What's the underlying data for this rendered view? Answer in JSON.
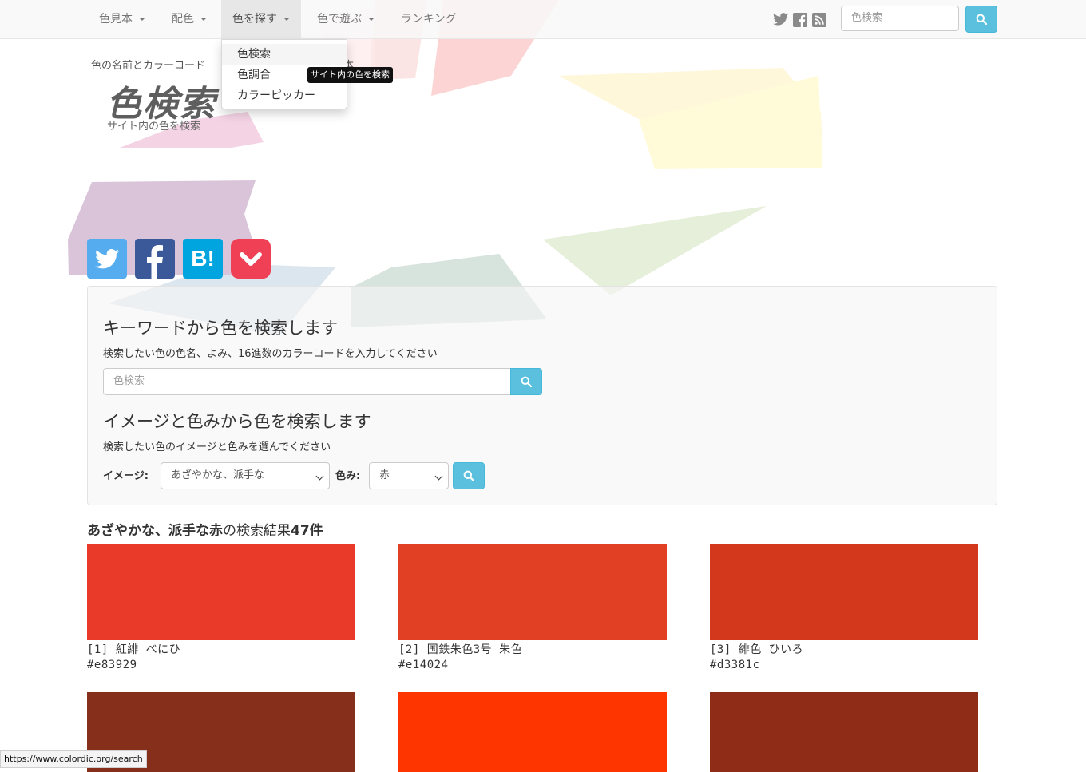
{
  "nav": {
    "items": [
      {
        "label": "色見本",
        "dropdown": true
      },
      {
        "label": "配色",
        "dropdown": true
      },
      {
        "label": "色を探す",
        "dropdown": true,
        "active": true
      },
      {
        "label": "色で遊ぶ",
        "dropdown": true
      },
      {
        "label": "ランキング",
        "dropdown": false
      }
    ],
    "social_icons": [
      "twitter-icon",
      "facebook-icon",
      "rss-icon"
    ],
    "search_placeholder": "色検索"
  },
  "dropdown": {
    "items": [
      "色検索",
      "色調合",
      "カラーピッカー"
    ],
    "tooltip": "サイト内の色を検索"
  },
  "header": {
    "tagline": "色の名前とカラーコード",
    "tagline_tail": "本",
    "logo": "色検索",
    "logo_sub": "サイト内の色を検索"
  },
  "share_buttons": [
    {
      "icon": "twitter-icon",
      "color": "#55acee"
    },
    {
      "icon": "facebook-icon",
      "color": "#3b5998"
    },
    {
      "icon": "hatena-icon",
      "color": "#00a4de",
      "text": "B!"
    },
    {
      "icon": "pocket-icon",
      "color": "#ef4056"
    }
  ],
  "search": {
    "keyword_title": "キーワードから色を検索します",
    "keyword_help": "検索したい色の色名、よみ、16進数のカラーコードを入力してください",
    "keyword_placeholder": "色検索",
    "image_title": "イメージと色みから色を検索します",
    "image_help": "検索したい色のイメージと色みを選んでください",
    "image_label": "イメージ:",
    "image_value": "あざやかな、派手な",
    "hue_label": "色み:",
    "hue_value": "赤"
  },
  "results": {
    "image": "あざやかな、派手な",
    "hue": "赤",
    "suffix": "の検索結果",
    "count": "47件",
    "colors": [
      {
        "label": "[1] 紅緋 べにひ",
        "hex": "#e83929"
      },
      {
        "label": "[2] 国鉄朱色3号 朱色",
        "hex": "#e14024"
      },
      {
        "label": "[3] 緋色 ひいろ",
        "hex": "#d3381c"
      }
    ],
    "second_row_colors": [
      "#862f1b",
      "#ff3500",
      "#8f2c17"
    ]
  },
  "status_bar": "https://www.colordic.org/search"
}
